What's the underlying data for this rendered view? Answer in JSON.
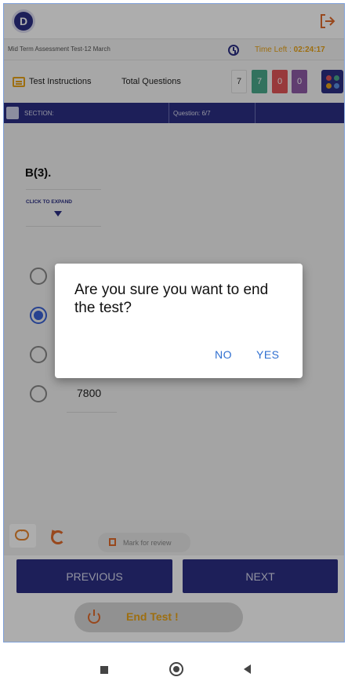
{
  "app": {
    "logo_letter": "D",
    "test_name": "Mid Term Assessment Test-12 March",
    "time_left_label": "Time Left :",
    "time_left_value": "02:24:17"
  },
  "toolbar_top": {
    "instructions_label": "Test Instructions",
    "total_questions_label": "Total Questions",
    "counts": [
      "7",
      "7",
      "0",
      "0"
    ],
    "count_colors": [
      "#fafafa",
      "#4aa98b",
      "#e05458",
      "#8e5aa6"
    ],
    "grid_dot_colors": [
      "#e05458",
      "#4aa98b",
      "#e8a318",
      "#5a8fe0"
    ]
  },
  "section_bar": {
    "section_label": "SECTION:",
    "question_label": "Question: 6/7"
  },
  "question": {
    "title": "B(3).",
    "expand_label": "CLICK TO EXPAND",
    "options": [
      {
        "text": "",
        "selected": false
      },
      {
        "text": "",
        "selected": true
      },
      {
        "text": "",
        "selected": false
      },
      {
        "text": "7800",
        "selected": false
      }
    ]
  },
  "dialog": {
    "message": "Are you sure you want to end the test?",
    "no_label": "NO",
    "yes_label": "YES"
  },
  "bottom": {
    "mark_review_label": "Mark for review",
    "previous_label": "PREVIOUS",
    "next_label": "NEXT",
    "end_test_label": "End Test !"
  },
  "colors": {
    "primary": "#2b2f83",
    "accent": "#e8a318",
    "dialog_button": "#2f6fd0"
  },
  "icons": [
    "logout-icon",
    "clock-icon",
    "instructions-icon",
    "grid-icon",
    "section-icon",
    "chevron-down-icon",
    "chat-icon",
    "reload-icon",
    "bookmark-icon",
    "power-icon"
  ]
}
